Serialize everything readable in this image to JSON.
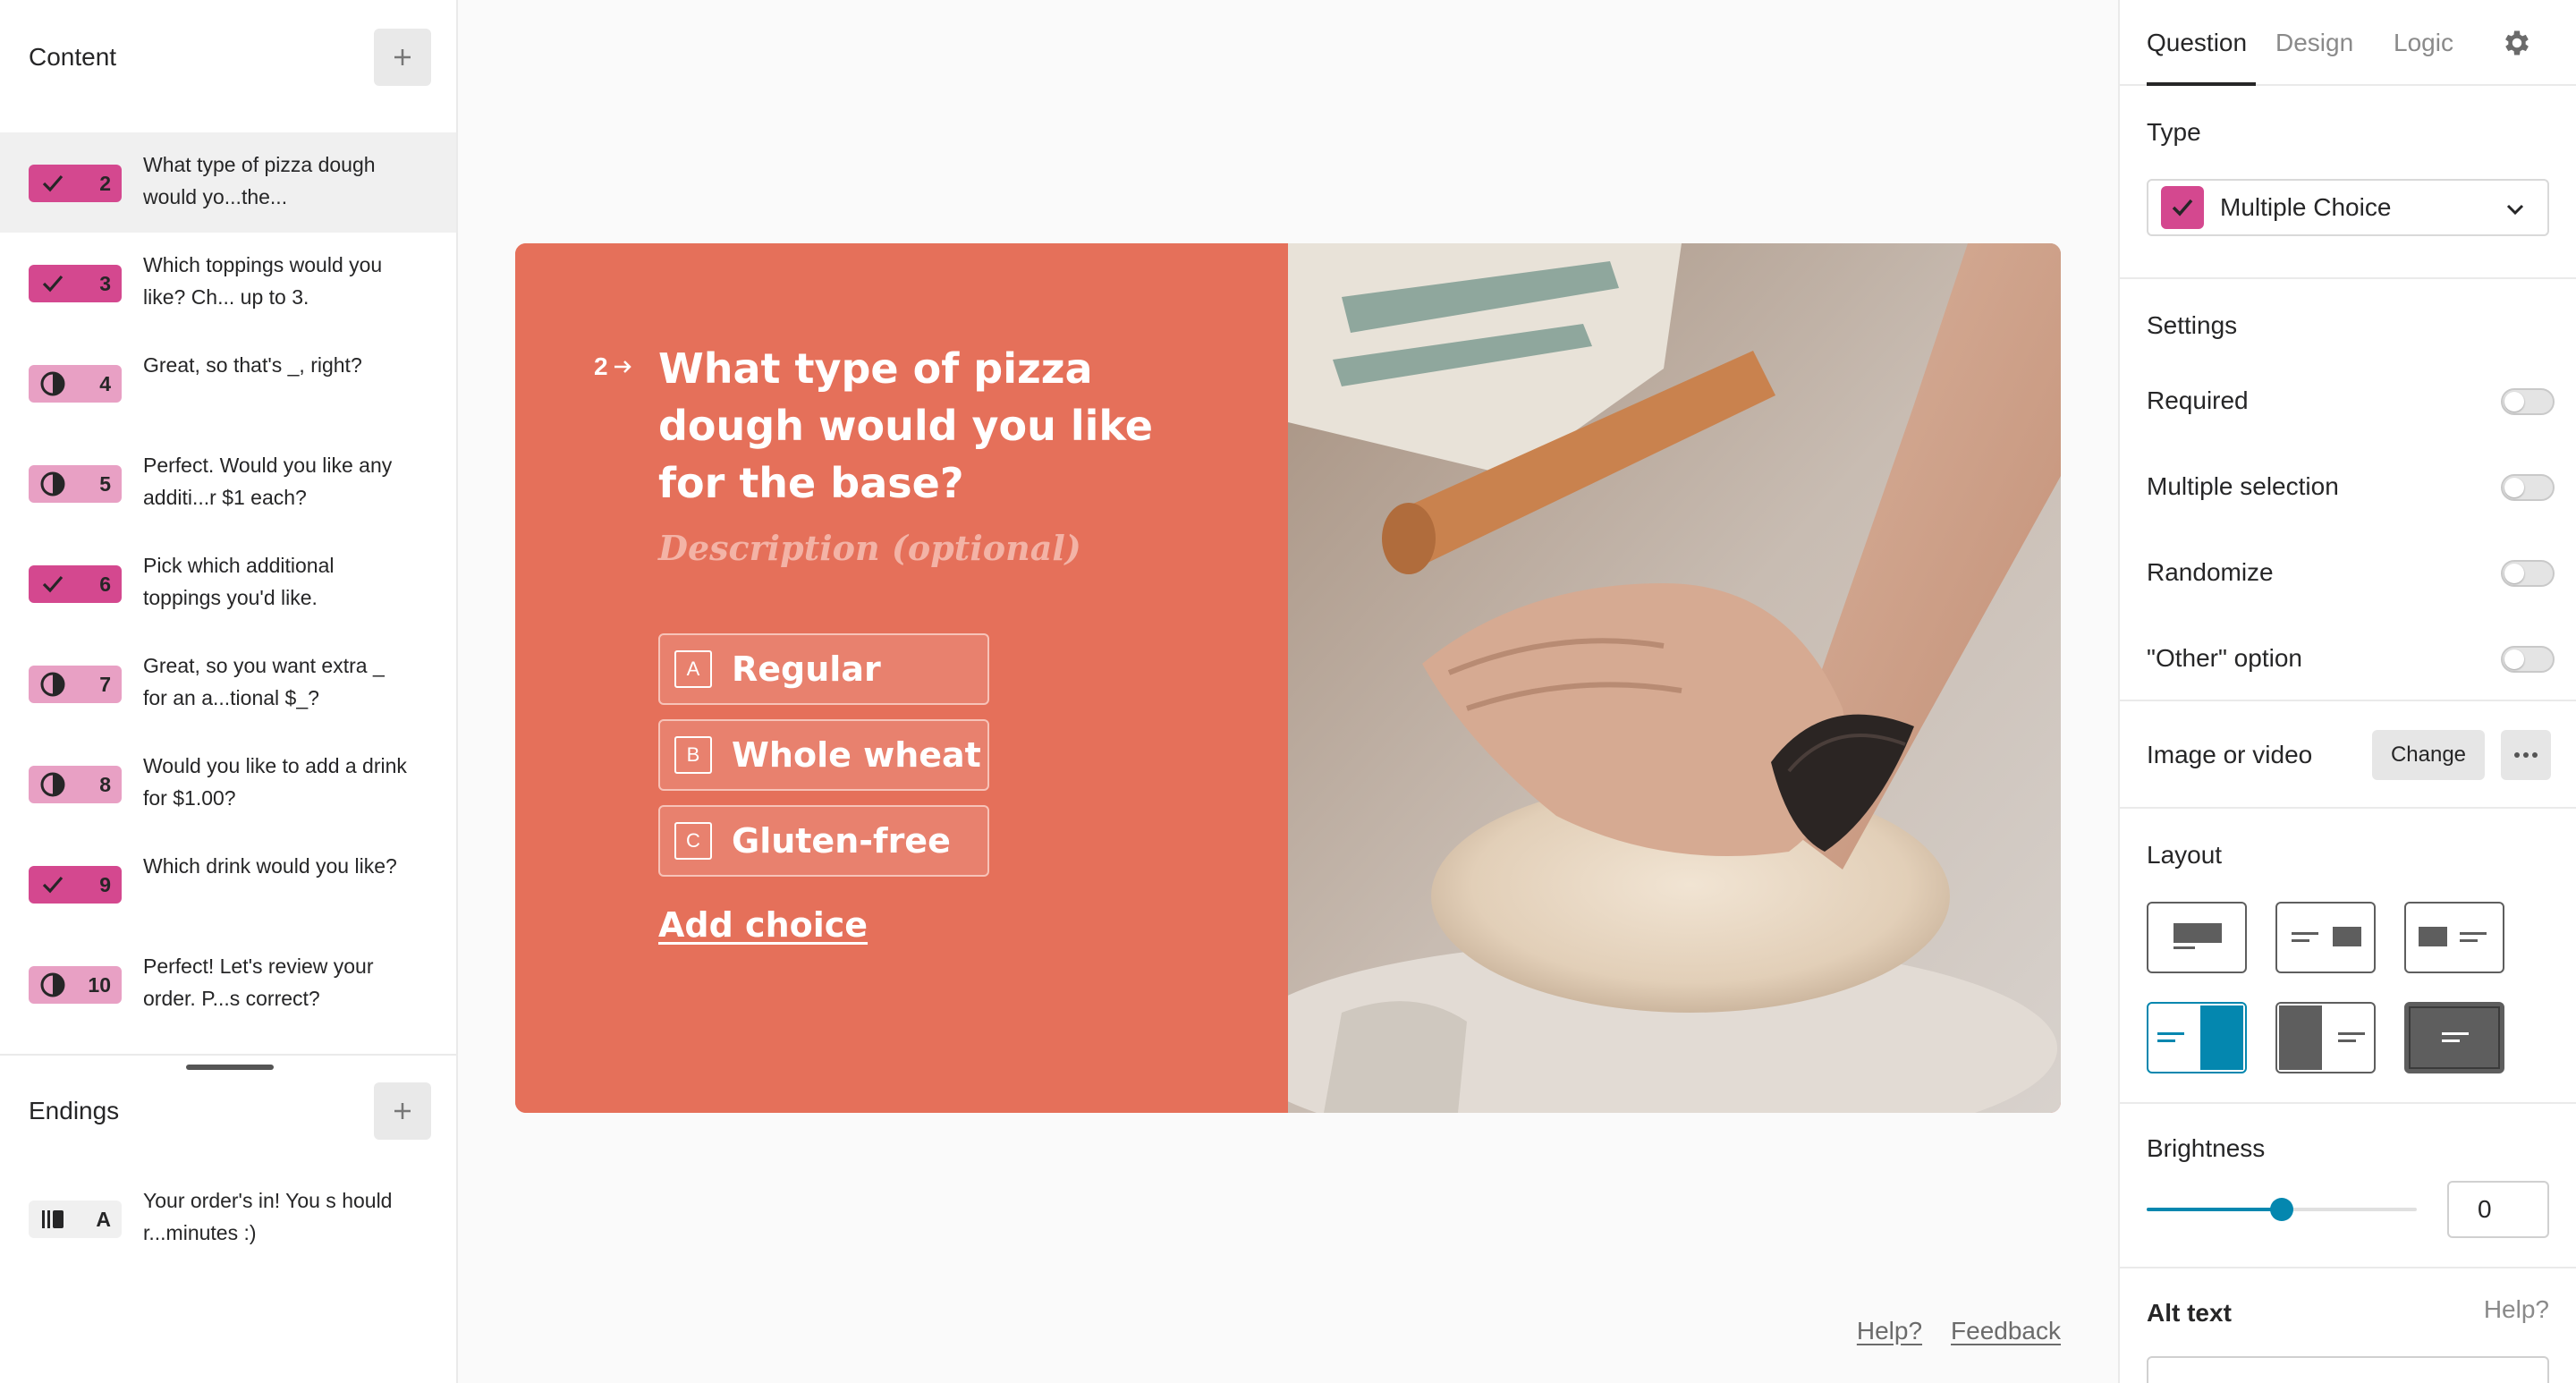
{
  "sidebar": {
    "content_title": "Content",
    "endings_title": "Endings",
    "questions": [
      {
        "type": "multiple-choice",
        "number": "2",
        "text": "What type of pizza dough would yo...the...",
        "active": true
      },
      {
        "type": "multiple-choice",
        "number": "3",
        "text": "Which toppings would you like? Ch... up to 3."
      },
      {
        "type": "yes-no",
        "number": "4",
        "text": "Great, so that's _, right?"
      },
      {
        "type": "yes-no",
        "number": "5",
        "text": "Perfect. Would you like any additi...r $1 each?"
      },
      {
        "type": "multiple-choice",
        "number": "6",
        "text": "Pick which additional toppings you'd like."
      },
      {
        "type": "yes-no",
        "number": "7",
        "text": "Great, so you want extra _ for an a...tional $_?"
      },
      {
        "type": "yes-no",
        "number": "8",
        "text": "Would you like to add a drink for $1.00?"
      },
      {
        "type": "multiple-choice",
        "number": "9",
        "text": "Which drink would you like?"
      },
      {
        "type": "yes-no",
        "number": "10",
        "text": "Perfect! Let's review your order. P...s correct?"
      }
    ],
    "endings": [
      {
        "type": "ending",
        "number": "A",
        "text": "Your order's in! You s hould r...minutes :)"
      }
    ]
  },
  "canvas": {
    "question_number": "2",
    "question_title": "What type of pizza dough would you like for the base?",
    "description_placeholder": "Description (optional)",
    "choices": [
      {
        "key": "A",
        "label": "Regular"
      },
      {
        "key": "B",
        "label": "Whole wheat"
      },
      {
        "key": "C",
        "label": "Gluten-free"
      }
    ],
    "add_choice": "Add choice",
    "card_color": "#e5705a"
  },
  "footer": {
    "help": "Help?",
    "feedback": "Feedback"
  },
  "panel": {
    "tabs": [
      "Question",
      "Design",
      "Logic"
    ],
    "active_tab": "Question",
    "type_label": "Type",
    "type_value": "Multiple Choice",
    "settings_label": "Settings",
    "settings": [
      {
        "label": "Required",
        "on": false
      },
      {
        "label": "Multiple selection",
        "on": false
      },
      {
        "label": "Randomize",
        "on": false
      },
      {
        "label": "\"Other\" option",
        "on": false
      }
    ],
    "image_label": "Image or video",
    "change_button": "Change",
    "layout_label": "Layout",
    "selected_layout_index": 3,
    "brightness_label": "Brightness",
    "brightness_value": "0",
    "brightness_slider_fraction": 0.5,
    "alt_text_label": "Alt text",
    "alt_help": "Help?",
    "accent_color": "#0487af"
  }
}
